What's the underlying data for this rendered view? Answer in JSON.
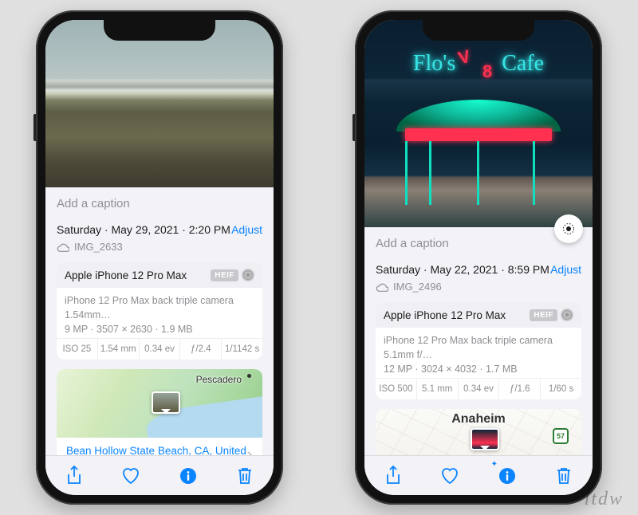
{
  "phones": [
    {
      "caption_placeholder": "Add a caption",
      "date_text": "Saturday · May 29, 2021 · 2:20 PM",
      "adjust_label": "Adjust",
      "filename": "IMG_2633",
      "device": "Apple iPhone 12 Pro Max",
      "format_badge": "HEIF",
      "lens_line": "iPhone 12 Pro Max back triple camera 1.54mm…",
      "dims_line": "9 MP · 3507 × 2630 · 1.9 MB",
      "exif": {
        "iso": "ISO 25",
        "focal": "1.54 mm",
        "ev": "0.34 ev",
        "fstop": "ƒ/2.4",
        "shutter": "1/1142 s"
      },
      "map": {
        "label": "Pescadero",
        "location": "Bean Hollow State Beach, CA, United States"
      }
    },
    {
      "caption_placeholder": "Add a caption",
      "date_text": "Saturday · May 22, 2021 · 8:59 PM",
      "adjust_label": "Adjust",
      "filename": "IMG_2496",
      "device": "Apple iPhone 12 Pro Max",
      "format_badge": "HEIF",
      "lens_line": "iPhone 12 Pro Max back triple camera 5.1mm f/…",
      "dims_line": "12 MP · 3024 × 4032 · 1.7 MB",
      "exif": {
        "iso": "ISO 500",
        "focal": "5.1 mm",
        "ev": "0.34 ev",
        "fstop": "ƒ/1.6",
        "shutter": "1/60 s"
      },
      "map": {
        "label": "Anaheim",
        "hwy": "57"
      },
      "sign": {
        "left": "Flo's",
        "right": "Cafe"
      }
    }
  ],
  "watermark": "itdw"
}
